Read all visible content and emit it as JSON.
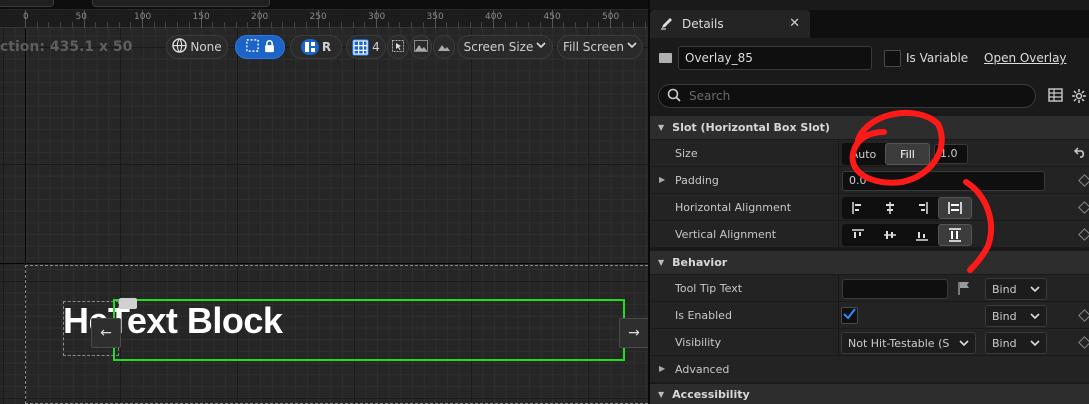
{
  "canvas": {
    "ruler_ticks": [
      "0",
      "50",
      "100",
      "150",
      "200",
      "250",
      "300",
      "350",
      "400",
      "450",
      "500"
    ],
    "dimension_text": "ction: 435.1 x 50",
    "toolbar": {
      "none_label": "None",
      "respect_label": "R",
      "grid_count": "4",
      "screen_size_label": "Screen Size",
      "fill_screen_label": "Fill Screen"
    },
    "widget_text": "HeText Block",
    "left_arrow": "←",
    "right_arrow": "→"
  },
  "details": {
    "tab_title": "Details",
    "tab_close": "✕",
    "widget_name": "Overlay_85",
    "is_variable_label": "Is Variable",
    "open_overlay_label": "Open Overlay",
    "search_placeholder": "Search",
    "slot_category": {
      "title": "Slot (Horizontal Box Slot)",
      "size": {
        "label": "Size",
        "auto": "Auto",
        "fill": "Fill",
        "value": "1.0",
        "selected": "Fill"
      },
      "padding": {
        "label": "Padding",
        "value": "0.0"
      },
      "horizontal_alignment": {
        "label": "Horizontal Alignment",
        "selected_index": 3
      },
      "vertical_alignment": {
        "label": "Vertical Alignment",
        "selected_index": 3
      }
    },
    "behavior_category": {
      "title": "Behavior",
      "tool_tip": {
        "label": "Tool Tip Text",
        "value": "",
        "bind": "Bind"
      },
      "is_enabled": {
        "label": "Is Enabled",
        "checked": true,
        "bind": "Bind"
      },
      "visibility": {
        "label": "Visibility",
        "value": "Not Hit-Testable (S",
        "bind": "Bind"
      }
    },
    "advanced_category": {
      "title": "Advanced"
    },
    "accessibility_category": {
      "title": "Accessibility"
    }
  },
  "colors": {
    "accent_blue": "#1c64c8",
    "selection_green": "#22dd22",
    "annotation_red": "#ff1a1a",
    "panel_bg": "#1a1a1a"
  }
}
